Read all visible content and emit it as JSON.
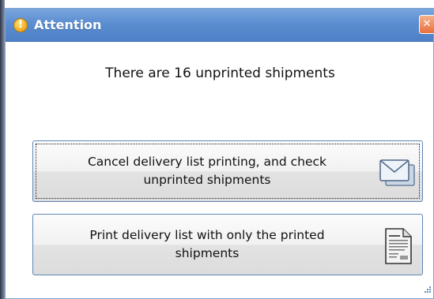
{
  "dialog": {
    "title": "Attention",
    "title_icon": "warning-icon",
    "close_icon": "close-icon",
    "message": "There are 16 unprinted shipments",
    "buttons": [
      {
        "label_line1": "Cancel delivery list printing, and check",
        "label_line2": "unprinted shipments",
        "icon": "envelope-icon",
        "focused": true
      },
      {
        "label_line1": "Print delivery list with only the printed",
        "label_line2": "shipments",
        "icon": "document-icon",
        "focused": false
      }
    ]
  },
  "colors": {
    "titlebar": "#5b8dd0",
    "title_text": "#ffffff",
    "button_border": "#5d86b3",
    "close_button": "#e8703d"
  }
}
